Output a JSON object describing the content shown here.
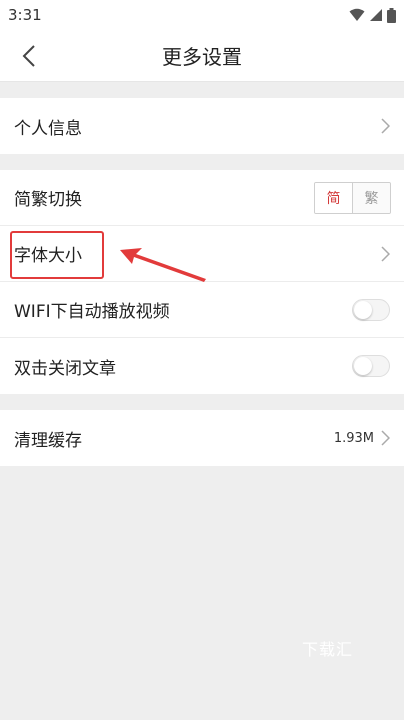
{
  "status_bar": {
    "time": "3:31"
  },
  "header": {
    "title": "更多设置"
  },
  "rows": {
    "personal_info": "个人信息",
    "simp_trad": {
      "label": "简繁切换",
      "simplified": "简",
      "traditional": "繁"
    },
    "font_size": "字体大小",
    "wifi_autoplay": "WIFI下自动播放视频",
    "double_tap_close": "双击关闭文章",
    "clear_cache": {
      "label": "清理缓存",
      "size": "1.93M"
    }
  },
  "watermark": "下载汇",
  "colors": {
    "accent_red": "#d33a3a",
    "background": "#eeeeee"
  }
}
